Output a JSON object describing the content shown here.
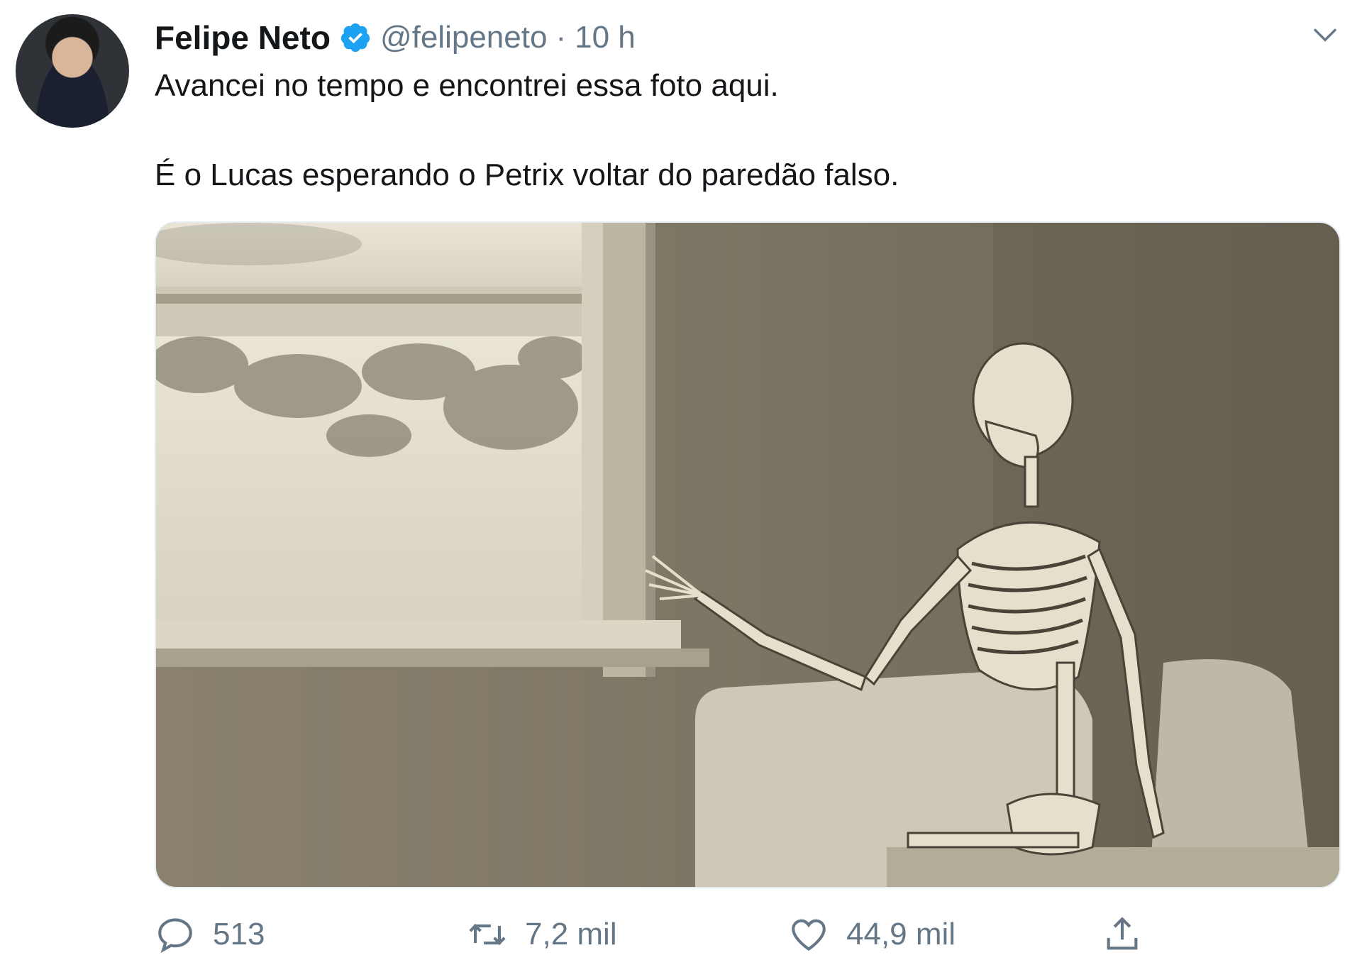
{
  "tweet": {
    "author_name": "Felipe Neto",
    "handle": "@felipeneto",
    "separator": "·",
    "time": "10 h",
    "text_line1": "Avancei no tempo e encontrei essa foto aqui.",
    "text_line2": "É o Lucas esperando o Petrix voltar do paredão falso."
  },
  "actions": {
    "replies": "513",
    "retweets": "7,2 mil",
    "likes": "44,9 mil"
  },
  "icons": {
    "verified": "verified-badge-icon",
    "more": "chevron-down-icon",
    "reply": "reply-icon",
    "retweet": "retweet-icon",
    "like": "heart-icon",
    "share": "share-icon"
  },
  "colors": {
    "verified": "#1da1f2",
    "secondary_text": "#657786",
    "primary_text": "#14171a"
  }
}
